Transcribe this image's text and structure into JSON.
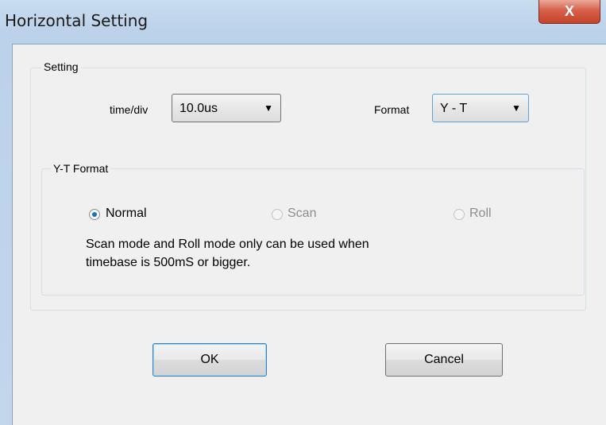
{
  "window": {
    "title": "Horizontal Setting",
    "close_glyph": "X"
  },
  "setting_group": {
    "label": "Setting"
  },
  "time_div": {
    "label": "time/div",
    "value": "10.0us",
    "arrow": "▼"
  },
  "format": {
    "label": "Format",
    "value": "Y - T",
    "arrow": "▼"
  },
  "yt_group": {
    "label": "Y-T Format",
    "options": [
      {
        "label": "Normal",
        "checked": true,
        "enabled": true
      },
      {
        "label": "Scan",
        "checked": false,
        "enabled": false
      },
      {
        "label": "Roll",
        "checked": false,
        "enabled": false
      }
    ],
    "note_line1": "Scan mode and Roll mode only can be used when",
    "note_line2": "timebase is 500mS or bigger."
  },
  "buttons": {
    "ok": "OK",
    "cancel": "Cancel"
  }
}
